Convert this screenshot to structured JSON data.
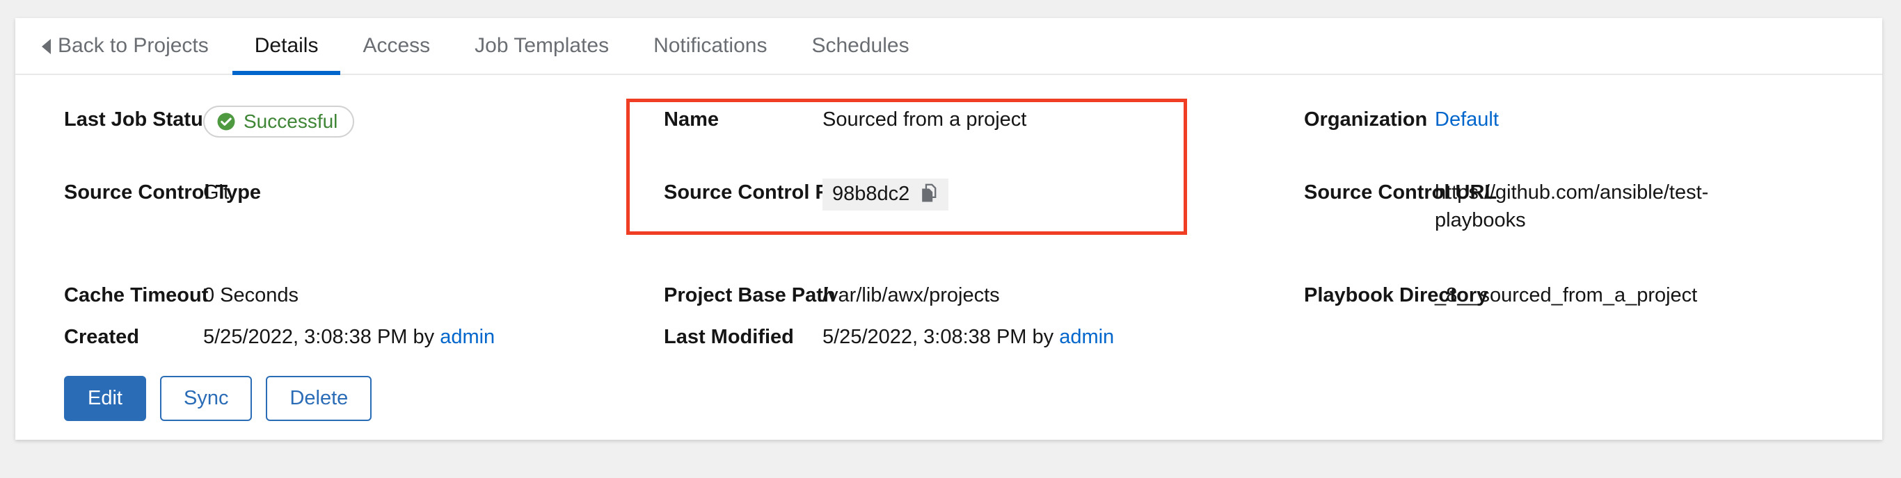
{
  "tabs": [
    {
      "label": "Back to Projects",
      "name": "tab-back-to-projects",
      "active": false,
      "back": true
    },
    {
      "label": "Details",
      "name": "tab-details",
      "active": true
    },
    {
      "label": "Access",
      "name": "tab-access",
      "active": false
    },
    {
      "label": "Job Templates",
      "name": "tab-job-templates",
      "active": false
    },
    {
      "label": "Notifications",
      "name": "tab-notifications",
      "active": false
    },
    {
      "label": "Schedules",
      "name": "tab-schedules",
      "active": false
    }
  ],
  "details": {
    "last_job_status": {
      "label": "Last Job Status",
      "value": "Successful",
      "icon": "check-circle-icon",
      "color": "#3e8635"
    },
    "name": {
      "label": "Name",
      "value": "Sourced from a project"
    },
    "organization": {
      "label": "Organization",
      "value": "Default",
      "link": true,
      "color": "#0066cc"
    },
    "source_control_type": {
      "label": "Source Control Type",
      "value": "Git"
    },
    "source_control_revision": {
      "label": "Source Control Revision",
      "value": "98b8dc2",
      "icon": "copy-icon"
    },
    "source_control_url": {
      "label": "Source Control URL",
      "value": "https://github.com/ansible/test-playbooks"
    },
    "cache_timeout": {
      "label": "Cache Timeout",
      "value": "0 Seconds"
    },
    "project_base_path": {
      "label": "Project Base Path",
      "value": "/var/lib/awx/projects"
    },
    "playbook_directory": {
      "label": "Playbook Directory",
      "value": "_8__sourced_from_a_project"
    },
    "created": {
      "label": "Created",
      "value": "5/25/2022, 3:08:38 PM by ",
      "user": "admin"
    },
    "last_modified": {
      "label": "Last Modified",
      "value": "5/25/2022, 3:08:38 PM by ",
      "user": "admin"
    }
  },
  "actions": {
    "edit": "Edit",
    "sync": "Sync",
    "delete": "Delete"
  },
  "annotation": {
    "highlight_color": "#ef3e24"
  }
}
